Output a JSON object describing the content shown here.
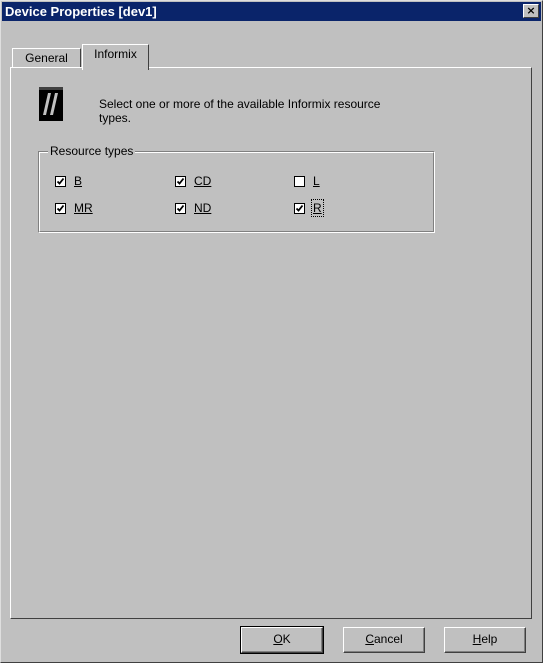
{
  "window": {
    "title": "Device Properties [dev1]",
    "close_glyph": "×"
  },
  "tabs": [
    {
      "label": "General",
      "active": false
    },
    {
      "label": "Informix",
      "active": true
    }
  ],
  "header": {
    "icon": "informix-logo-icon",
    "description": "Select one or more of the available Informix resource types."
  },
  "resource_types": {
    "label": "Resource types",
    "items": [
      {
        "label": "B",
        "checked": true
      },
      {
        "label": "CD",
        "checked": true
      },
      {
        "label": "L",
        "checked": false
      },
      {
        "label": "MR",
        "checked": true
      },
      {
        "label": "ND",
        "checked": true
      },
      {
        "label": "R",
        "checked": true
      }
    ]
  },
  "buttons": {
    "ok": "OK",
    "cancel": "Cancel",
    "help": "Help"
  },
  "colors": {
    "titlebar": "#0a246a",
    "face": "#c0c0c0"
  }
}
